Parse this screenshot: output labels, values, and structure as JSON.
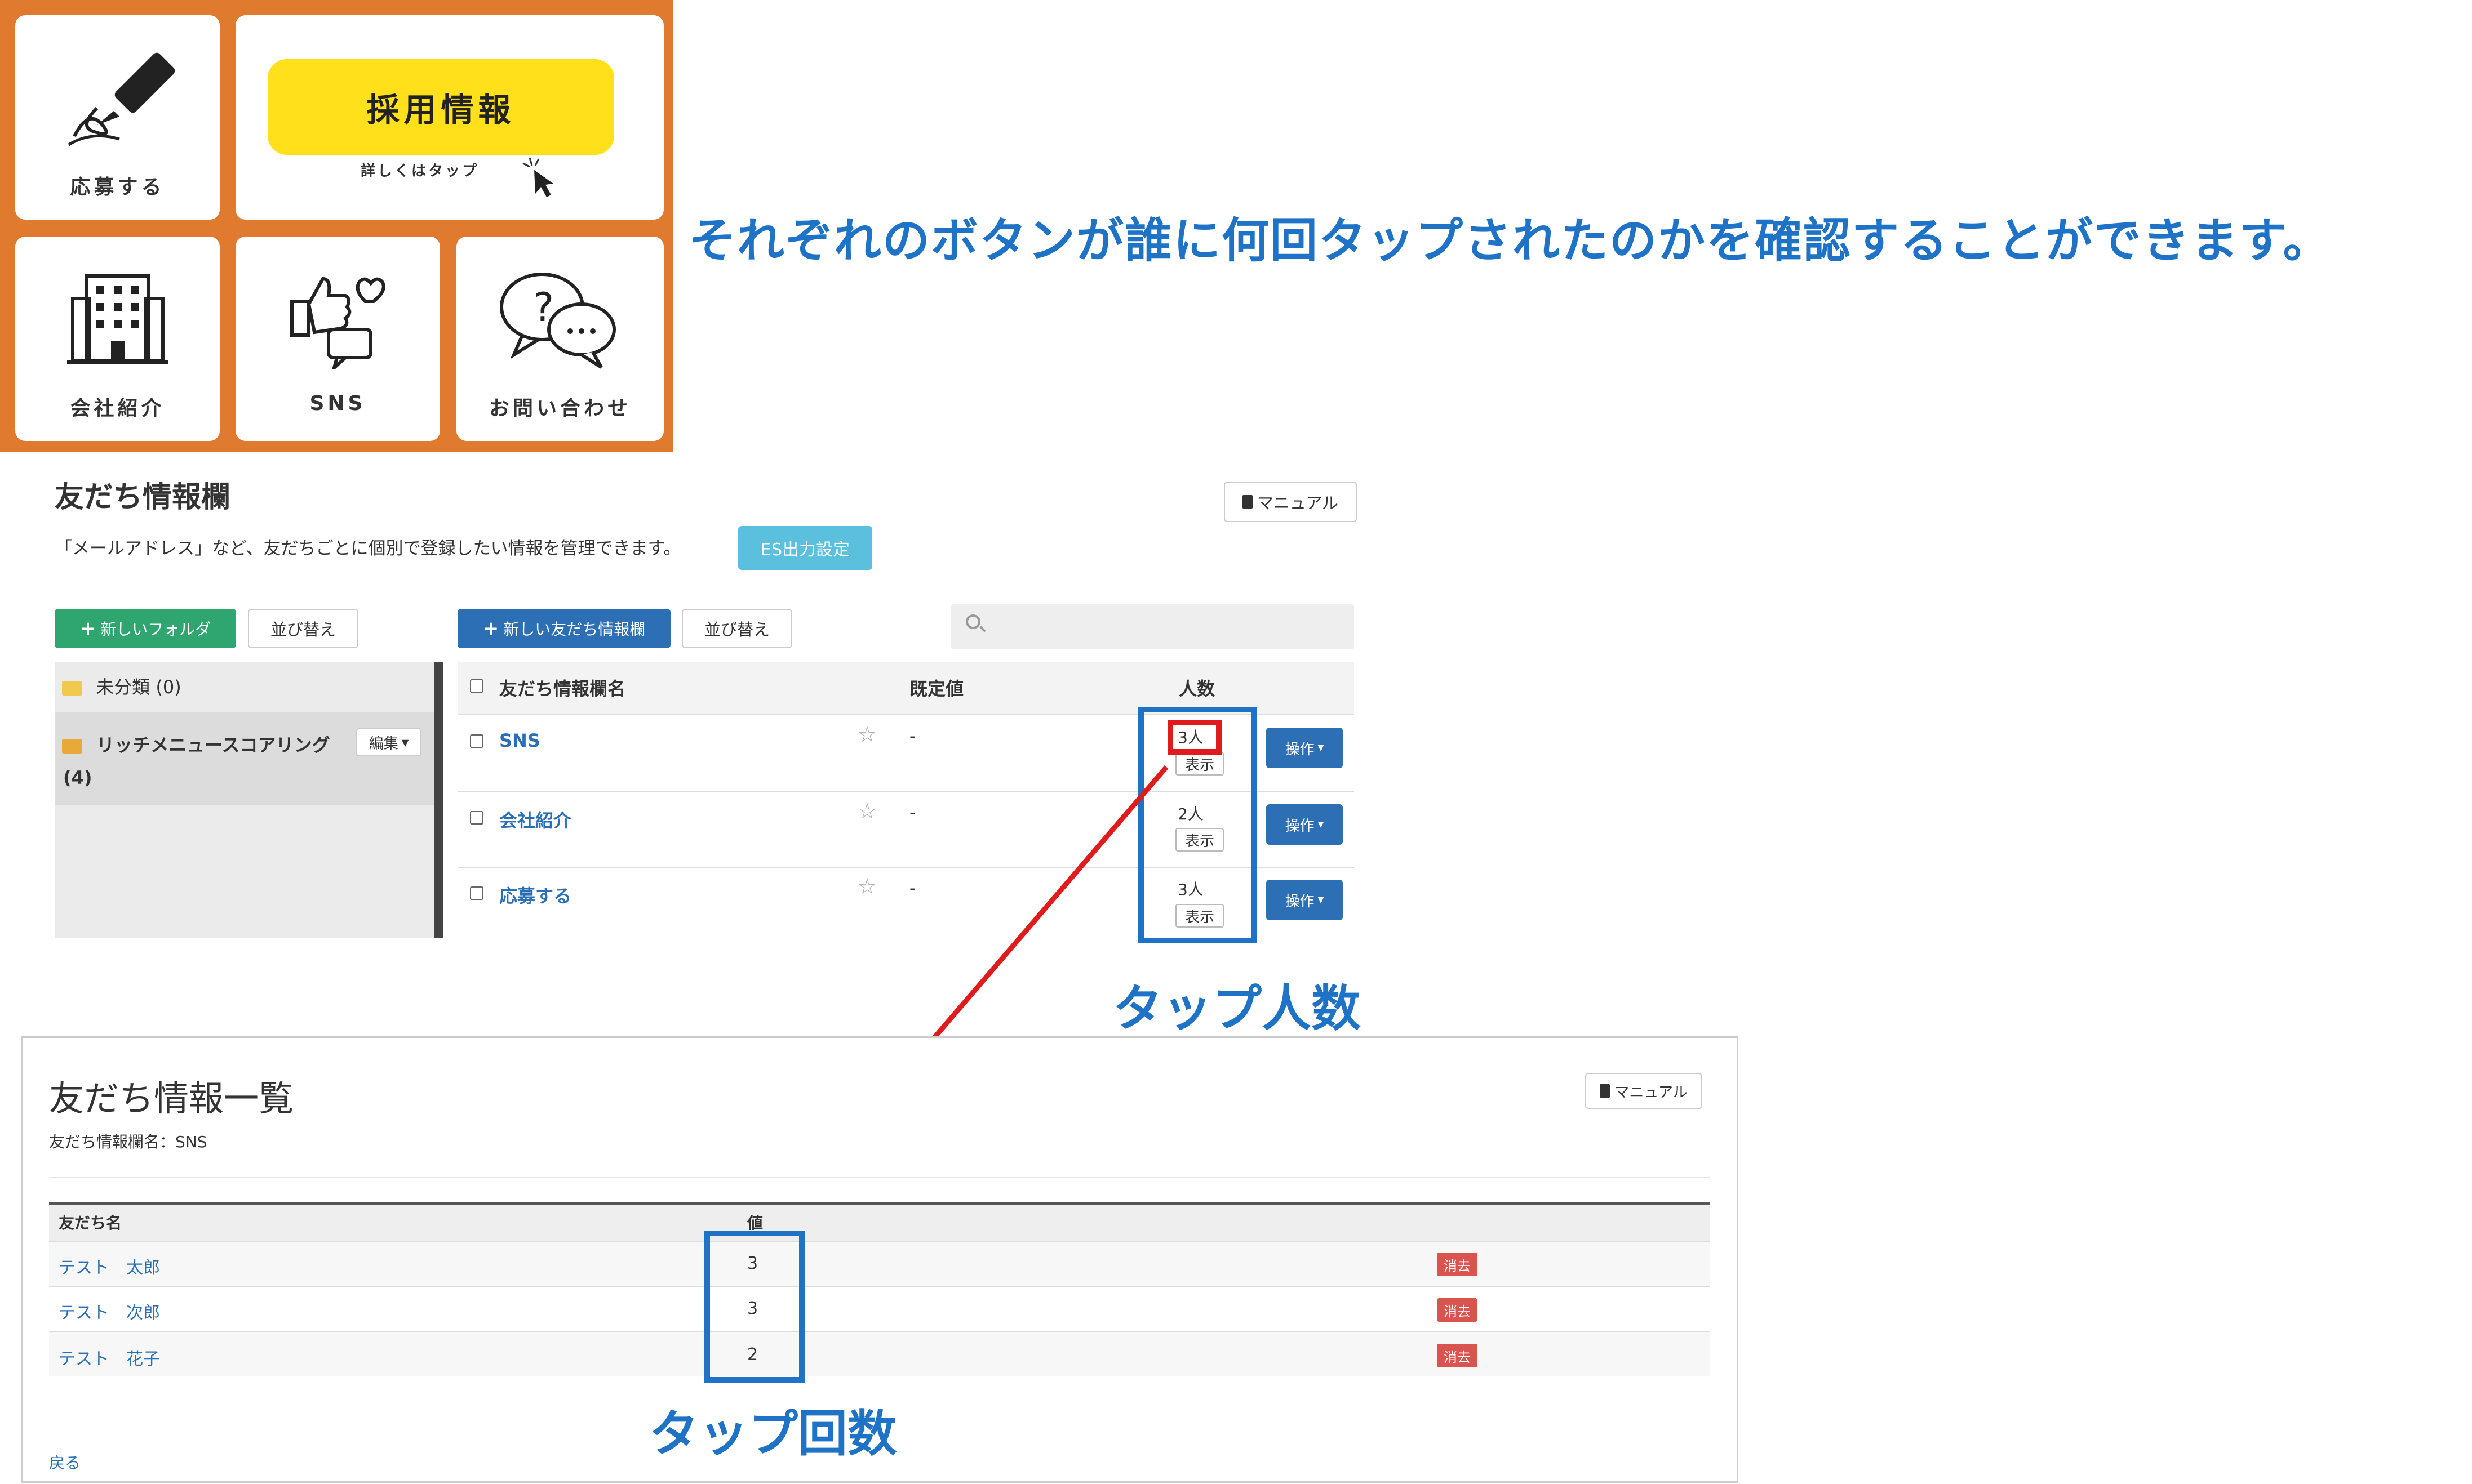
{
  "rich_menu": {
    "apply_label": "応募する",
    "recruit_label": "採用情報",
    "recruit_sub": "詳しくはタップ",
    "company_label": "会社紹介",
    "sns_label": "SNS",
    "contact_label": "お問い合わせ"
  },
  "headline": "それぞれのボタンが誰に何回タップされたのかを確認することができます。",
  "friend_info": {
    "title": "友だち情報欄",
    "description": "「メールアドレス」など、友だちごとに個別で登録したい情報を管理できます。",
    "es_button": "ES出力設定",
    "manual_button": "マニュアル",
    "new_folder_button": "新しいフォルダ",
    "sort_button_left": "並び替え",
    "new_field_button": "新しい友だち情報欄",
    "sort_button_right": "並び替え",
    "search_placeholder": "",
    "folders": [
      {
        "name": "未分類 (0)"
      },
      {
        "name": "リッチメニュースコアリング",
        "count": "(4)",
        "edit_label": "編集"
      }
    ],
    "columns": {
      "name": "友だち情報欄名",
      "default": "既定値",
      "count": "人数"
    },
    "rows": [
      {
        "name": "SNS",
        "default": "-",
        "count": "3人",
        "show": "表示",
        "op": "操作"
      },
      {
        "name": "会社紹介",
        "default": "-",
        "count": "2人",
        "show": "表示",
        "op": "操作"
      },
      {
        "name": "応募する",
        "default": "-",
        "count": "3人",
        "show": "表示",
        "op": "操作"
      }
    ]
  },
  "annotations": {
    "tap_people": "タップ人数",
    "tap_count": "タップ回数"
  },
  "friend_list": {
    "title": "友だち情報一覧",
    "subtitle": "友だち情報欄名：SNS",
    "manual_button": "マニュアル",
    "columns": {
      "name": "友だち名",
      "value": "値"
    },
    "rows": [
      {
        "name": "テスト　太郎",
        "value": "3",
        "delete": "消去"
      },
      {
        "name": "テスト　次郎",
        "value": "3",
        "delete": "消去"
      },
      {
        "name": "テスト　花子",
        "value": "2",
        "delete": "消去"
      }
    ],
    "back_link": "戻る"
  },
  "colors": {
    "menu_orange": "#e07a2e",
    "menu_yellow": "#ffe01a",
    "accent_blue": "#1f73c6",
    "annotation_red": "#e01b1b",
    "button_green": "#2fa66f",
    "button_blue": "#2c6fb5",
    "es_cyan": "#5bc0de",
    "delete_red": "#d9534f"
  }
}
